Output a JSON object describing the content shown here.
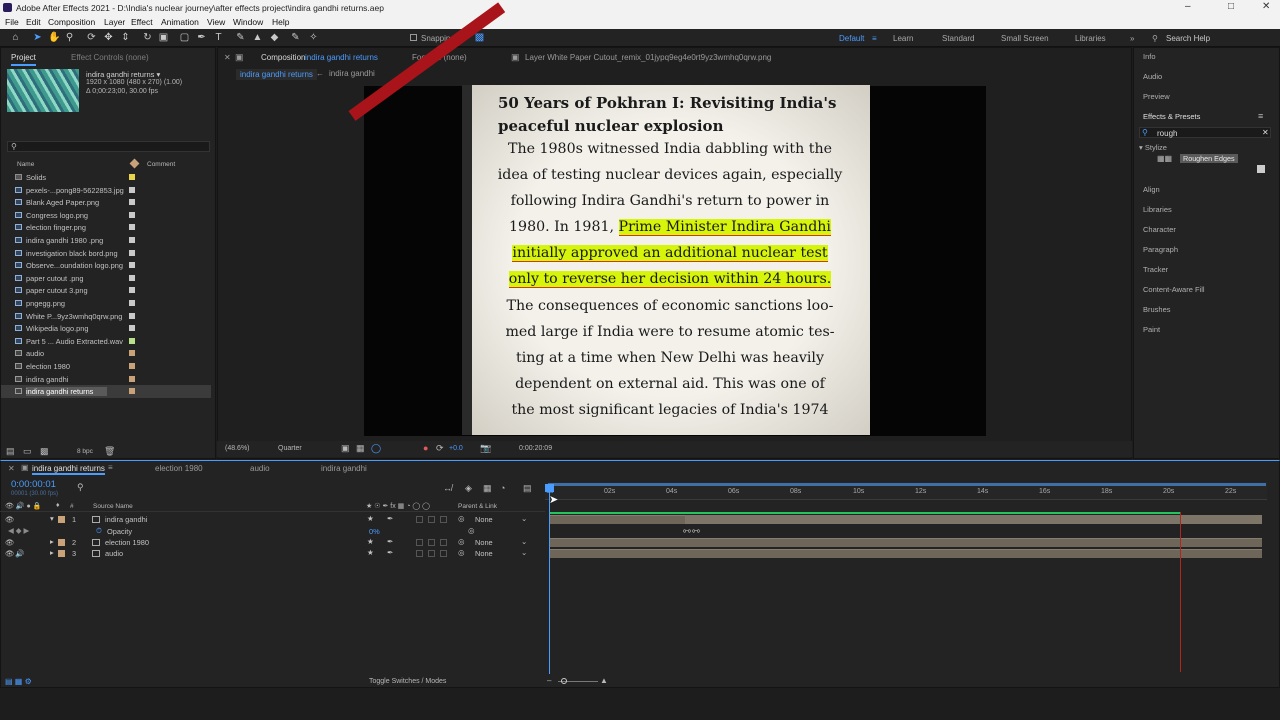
{
  "app": {
    "title": "Adobe After Effects 2021 - D:\\India's nuclear journey\\after effects project\\indira gandhi returns.aep"
  },
  "menu": [
    "File",
    "Edit",
    "Composition",
    "Layer",
    "Effect",
    "Animation",
    "View",
    "Window",
    "Help"
  ],
  "toolbar": {
    "snapping": "Snapping",
    "workspaces": [
      "Default",
      "Learn",
      "Standard",
      "Small Screen",
      "Libraries"
    ],
    "search": "Search Help"
  },
  "project": {
    "tab_project": "Project",
    "tab_effect_controls": "Effect Controls (none)",
    "comp_name": "indira gandhi returns ▾",
    "comp_info1": "1920 x 1080  (480 x 270) (1.00)",
    "comp_info2": "Δ 0;00:23;00, 30.00 fps",
    "col_name": "Name",
    "col_comment": "Comment",
    "bpc": "8 bpc",
    "items": [
      {
        "name": "Solids",
        "type": "folder",
        "color": "#e8d44a"
      },
      {
        "name": "pexels-...pong89-5622853.jpg",
        "type": "file",
        "color": "#c9c9c9"
      },
      {
        "name": "Blank Aged Paper.png",
        "type": "file",
        "color": "#c9c9c9"
      },
      {
        "name": "Congress logo.png",
        "type": "file",
        "color": "#c9c9c9"
      },
      {
        "name": "election finger.png",
        "type": "file",
        "color": "#c9c9c9"
      },
      {
        "name": "indira gandhi 1980 .png",
        "type": "file",
        "color": "#c9c9c9"
      },
      {
        "name": "investigation black bord.png",
        "type": "file",
        "color": "#c9c9c9"
      },
      {
        "name": "Observe...oundation logo.png",
        "type": "file",
        "color": "#c9c9c9"
      },
      {
        "name": "paper cutout .png",
        "type": "file",
        "color": "#c9c9c9"
      },
      {
        "name": "paper cutout 3.png",
        "type": "file",
        "color": "#c9c9c9"
      },
      {
        "name": "pngegg.png",
        "type": "file",
        "color": "#c9c9c9"
      },
      {
        "name": "White P...9yz3wmhq0qrw.png",
        "type": "file",
        "color": "#c9c9c9"
      },
      {
        "name": "Wikipedia logo.png",
        "type": "file",
        "color": "#c9c9c9"
      },
      {
        "name": "Part 5 ... Audio Extracted.wav",
        "type": "audio",
        "color": "#b8e08a"
      },
      {
        "name": "audio",
        "type": "comp",
        "color": "#c9a27a"
      },
      {
        "name": "election 1980",
        "type": "comp",
        "color": "#c9a27a"
      },
      {
        "name": "indira gandhi",
        "type": "comp",
        "color": "#c9a27a"
      },
      {
        "name": "indira gandhi returns",
        "type": "comp",
        "color": "#c9a27a",
        "selected": true
      }
    ]
  },
  "viewer": {
    "tab_comp": "Composition",
    "tab_comp_name": "indira gandhi returns",
    "tab_footage": "Footage (none)",
    "tab_layer": "Layer  White Paper Cutout_remix_01jypq9eg4e0rt9yz3wmhq0qrw.png",
    "crumb1": "indira gandhi returns",
    "crumb2": "indira gandhi",
    "zoom": "(48.6%)",
    "quality": "Quarter",
    "exposure": "+0.0",
    "timecode": "0:00:20:09",
    "doc": {
      "heading1": "50 Years of Pokhran I: Revisiting India's",
      "heading2": "peaceful nuclear explosion",
      "l1": "The 1980s witnessed India dabbling with the",
      "l2": "idea of testing nuclear devices again, especially",
      "l3": "following Indira Gandhi's return to power in",
      "l4a": "1980. In 1981, ",
      "l4b": "Prime Minister Indira Gandhi",
      "l5": "initially approved an additional nuclear test",
      "l6": "only to reverse her decision within 24 hours.",
      "l7": "The consequences of economic sanctions loo-",
      "l8": "med large if India were to resume atomic tes-",
      "l9": "ting at a time when New Delhi was heavily",
      "l10": "dependent on external aid. This was one of",
      "l11": "the most significant legacies of India's 1974"
    }
  },
  "right_panel": {
    "info": "Info",
    "audio": "Audio",
    "preview": "Preview",
    "effects": "Effects & Presets",
    "search_value": "rough",
    "stylize": "Stylize",
    "roughen": "Roughen Edges",
    "align": "Align",
    "libraries": "Libraries",
    "character": "Character",
    "paragraph": "Paragraph",
    "tracker": "Tracker",
    "caf": "Content-Aware Fill",
    "brushes": "Brushes",
    "paint": "Paint"
  },
  "timeline": {
    "tabs": [
      "indira gandhi returns",
      "election 1980",
      "audio",
      "indira gandhi"
    ],
    "timecode": "0:00:00:01",
    "fps": "00001 (30.00 fps)",
    "col_source": "Source Name",
    "col_parent": "Parent & Link",
    "ticks": [
      "0s",
      "02s",
      "04s",
      "06s",
      "08s",
      "10s",
      "12s",
      "14s",
      "16s",
      "18s",
      "20s",
      "22s"
    ],
    "layers": [
      {
        "num": "1",
        "name": "indira gandhi",
        "parent": "None"
      },
      {
        "num": "",
        "name": "Opacity",
        "value": "0%"
      },
      {
        "num": "2",
        "name": "election 1980",
        "parent": "None"
      },
      {
        "num": "3",
        "name": "audio",
        "parent": "None"
      }
    ],
    "toggle": "Toggle Switches / Modes"
  }
}
